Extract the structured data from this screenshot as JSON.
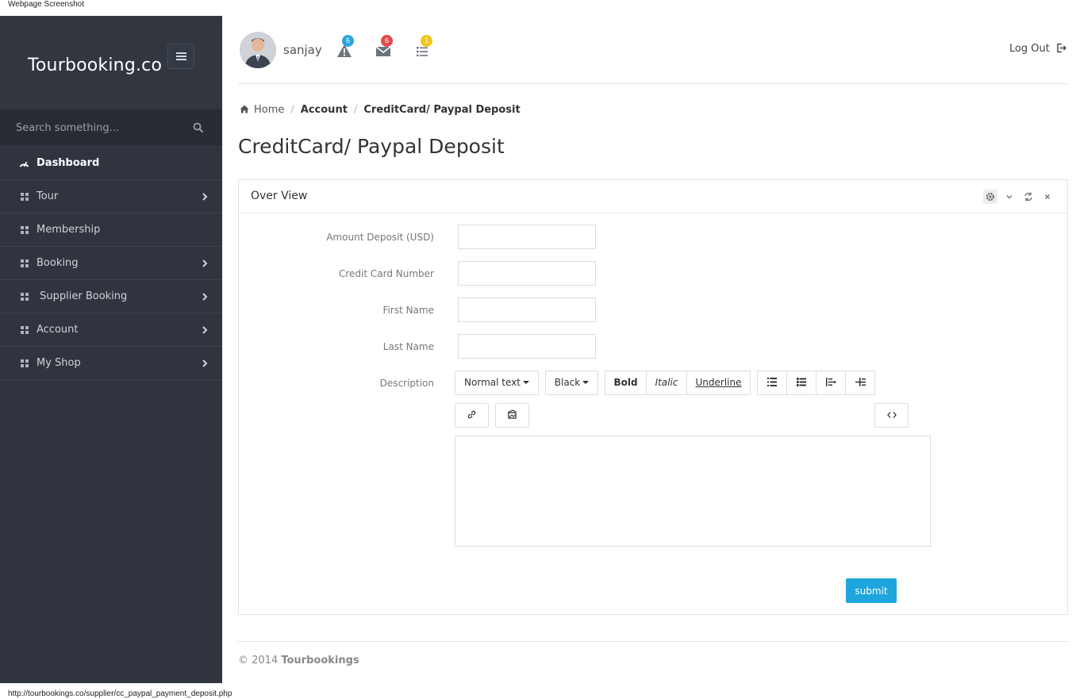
{
  "caption": "Webpage Screenshot",
  "status_url": "http://tourbookings.co/supplier/cc_paypal_payment_deposit.php",
  "sidebar": {
    "brand": "Tourbooking.co",
    "search_placeholder": "Search something...",
    "items": [
      {
        "label": "Dashboard",
        "icon": "dashboard-icon",
        "has_submenu": false
      },
      {
        "label": "Tour",
        "icon": "grid-icon",
        "has_submenu": true
      },
      {
        "label": "Membership",
        "icon": "grid-icon",
        "has_submenu": false
      },
      {
        "label": "Booking",
        "icon": "grid-icon",
        "has_submenu": true
      },
      {
        "label": " Supplier Booking",
        "icon": "grid-icon",
        "has_submenu": true
      },
      {
        "label": "Account",
        "icon": "grid-icon",
        "has_submenu": true
      },
      {
        "label": "My Shop",
        "icon": "grid-icon",
        "has_submenu": true
      }
    ]
  },
  "topbar": {
    "username": "sanjay",
    "alerts_count": "6",
    "messages_count": "6",
    "tasks_count": "1",
    "logout_label": "Log Out"
  },
  "breadcrumb": {
    "home": "Home",
    "account": "Account",
    "current": "CreditCard/ Paypal Deposit"
  },
  "page_title": "CreditCard/ Paypal Deposit",
  "panel": {
    "title": "Over View",
    "form": {
      "amount_label": "Amount Deposit (USD)",
      "amount_value": "",
      "card_label": "Credit Card Number",
      "card_value": "",
      "first_name_label": "First Name",
      "first_name_value": "",
      "last_name_label": "Last Name",
      "last_name_value": "",
      "description_label": "Description",
      "description_value": ""
    },
    "toolbar": {
      "style": "Normal text",
      "color": "Black",
      "bold": "Bold",
      "italic": "Italic",
      "underline": "Underline"
    },
    "submit_label": "submit"
  },
  "footer": {
    "copyright": "© 2014",
    "company": "Tourbookings"
  },
  "colors": {
    "sidebar_bg": "#2f343f",
    "accent": "#1fa5dd",
    "badge_alerts": "#29a5de",
    "badge_messages": "#e04c4c",
    "badge_tasks": "#f5c518"
  }
}
